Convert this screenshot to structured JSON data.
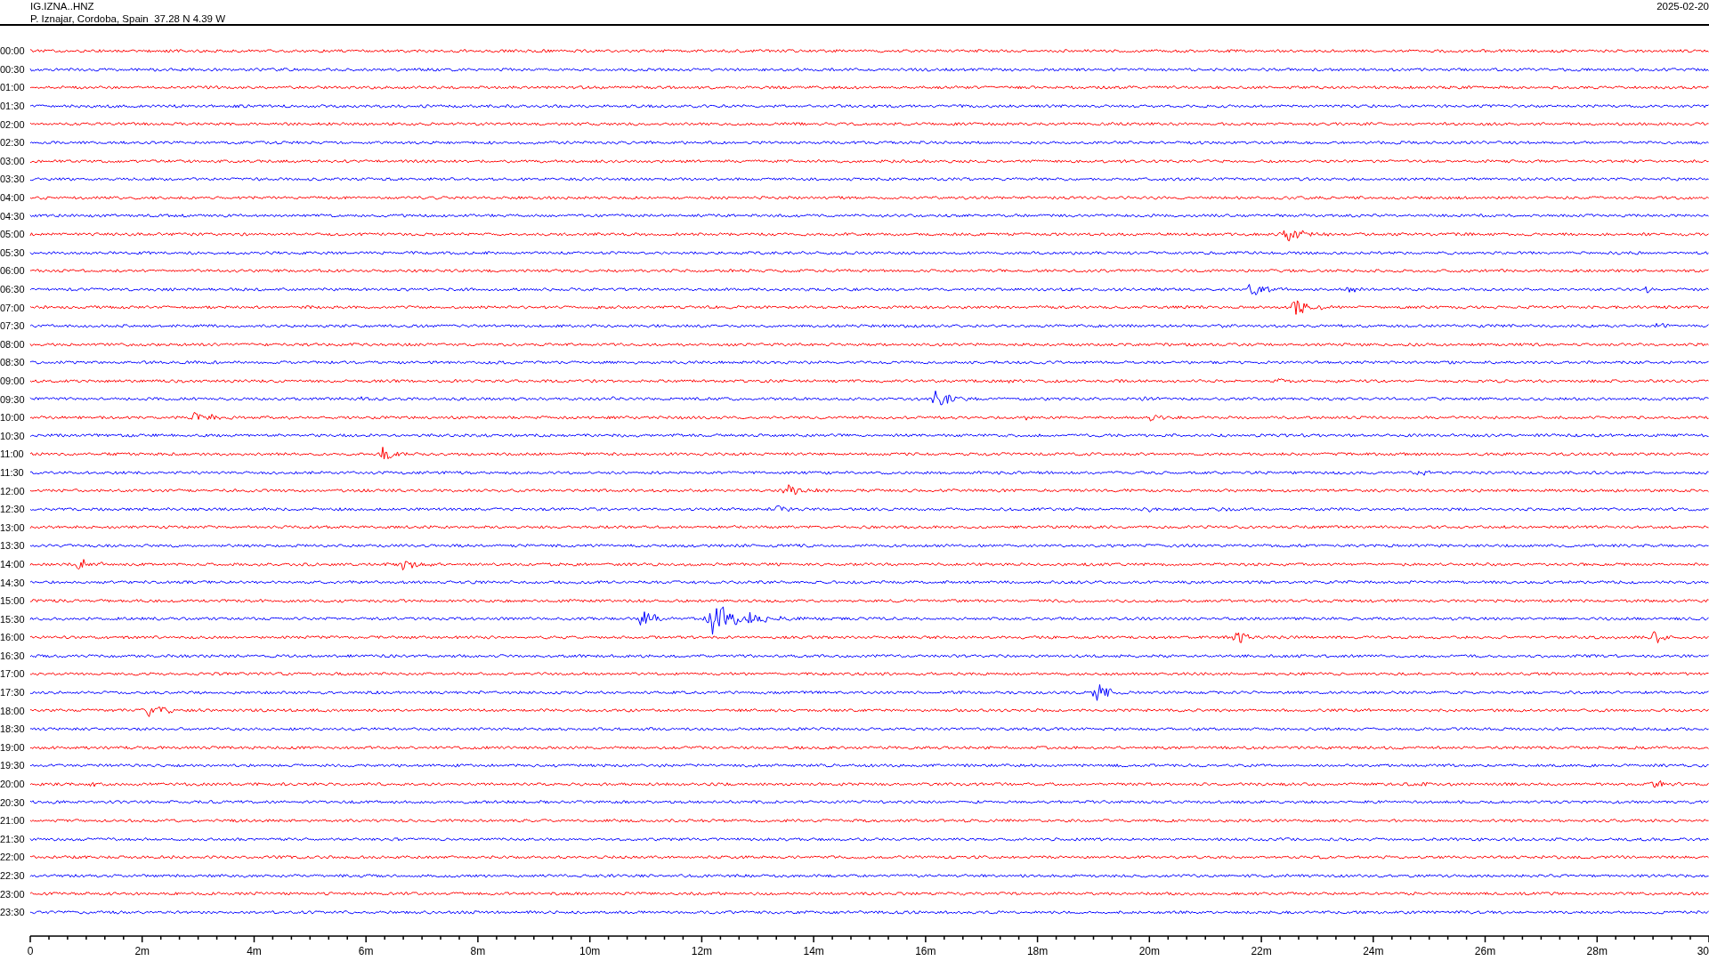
{
  "header": {
    "station": "IG.IZNA..HNZ",
    "location": "P. Iznajar, Cordoba, Spain  37.28 N 4.39 W",
    "date": "2025-02-20"
  },
  "traces": [
    {
      "label": "00:00",
      "color": "#ff0000"
    },
    {
      "label": "00:30",
      "color": "#0000ff"
    },
    {
      "label": "01:00",
      "color": "#ff0000"
    },
    {
      "label": "01:30",
      "color": "#0000ff"
    },
    {
      "label": "02:00",
      "color": "#ff0000"
    },
    {
      "label": "02:30",
      "color": "#0000ff"
    },
    {
      "label": "03:00",
      "color": "#ff0000"
    },
    {
      "label": "03:30",
      "color": "#0000ff"
    },
    {
      "label": "04:00",
      "color": "#ff0000"
    },
    {
      "label": "04:30",
      "color": "#0000ff"
    },
    {
      "label": "05:00",
      "color": "#ff0000"
    },
    {
      "label": "05:30",
      "color": "#0000ff"
    },
    {
      "label": "06:00",
      "color": "#ff0000"
    },
    {
      "label": "06:30",
      "color": "#0000ff"
    },
    {
      "label": "07:00",
      "color": "#ff0000"
    },
    {
      "label": "07:30",
      "color": "#0000ff"
    },
    {
      "label": "08:00",
      "color": "#ff0000"
    },
    {
      "label": "08:30",
      "color": "#0000ff"
    },
    {
      "label": "09:00",
      "color": "#ff0000"
    },
    {
      "label": "09:30",
      "color": "#0000ff"
    },
    {
      "label": "10:00",
      "color": "#ff0000"
    },
    {
      "label": "10:30",
      "color": "#0000ff"
    },
    {
      "label": "11:00",
      "color": "#ff0000"
    },
    {
      "label": "11:30",
      "color": "#0000ff"
    },
    {
      "label": "12:00",
      "color": "#ff0000"
    },
    {
      "label": "12:30",
      "color": "#0000ff"
    },
    {
      "label": "13:00",
      "color": "#ff0000"
    },
    {
      "label": "13:30",
      "color": "#0000ff"
    },
    {
      "label": "14:00",
      "color": "#ff0000"
    },
    {
      "label": "14:30",
      "color": "#0000ff"
    },
    {
      "label": "15:00",
      "color": "#ff0000"
    },
    {
      "label": "15:30",
      "color": "#0000ff"
    },
    {
      "label": "16:00",
      "color": "#ff0000"
    },
    {
      "label": "16:30",
      "color": "#0000ff"
    },
    {
      "label": "17:00",
      "color": "#ff0000"
    },
    {
      "label": "17:30",
      "color": "#0000ff"
    },
    {
      "label": "18:00",
      "color": "#ff0000"
    },
    {
      "label": "18:30",
      "color": "#0000ff"
    },
    {
      "label": "19:00",
      "color": "#ff0000"
    },
    {
      "label": "19:30",
      "color": "#0000ff"
    },
    {
      "label": "20:00",
      "color": "#ff0000"
    },
    {
      "label": "20:30",
      "color": "#0000ff"
    },
    {
      "label": "21:00",
      "color": "#ff0000"
    },
    {
      "label": "21:30",
      "color": "#0000ff"
    },
    {
      "label": "22:00",
      "color": "#ff0000"
    },
    {
      "label": "22:30",
      "color": "#0000ff"
    },
    {
      "label": "23:00",
      "color": "#ff0000"
    },
    {
      "label": "23:30",
      "color": "#0000ff"
    }
  ],
  "x_axis": {
    "tick_labels": [
      "0",
      "2m",
      "4m",
      "6m",
      "8m",
      "10m",
      "12m",
      "14m",
      "16m",
      "18m",
      "20m",
      "22m",
      "24m",
      "26m",
      "28m",
      "30"
    ]
  }
}
